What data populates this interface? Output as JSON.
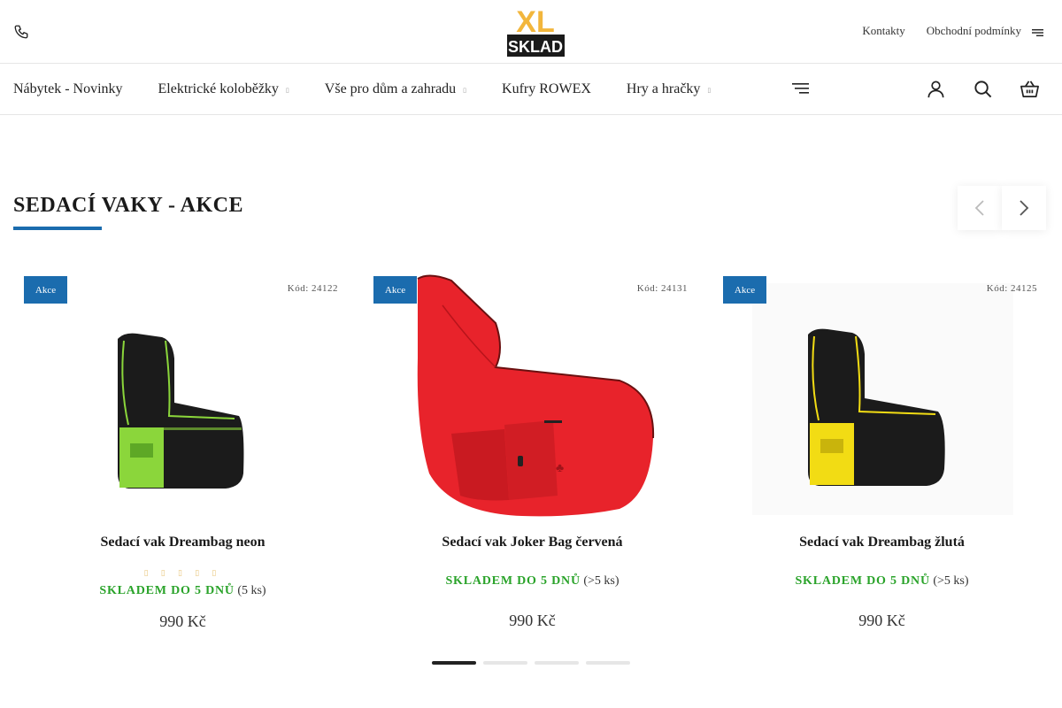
{
  "header": {
    "phone_icon": "phone-icon",
    "logo": {
      "top": "XL",
      "bottom": "SKLAD",
      "color": "#f2b63c"
    },
    "links": [
      "Kontakty",
      "Obchodní podmínky"
    ],
    "menu_icon": "menu-icon"
  },
  "nav": {
    "items": [
      {
        "label": "Nábytek - Novinky",
        "has_dropdown": false
      },
      {
        "label": "Elektrické koloběžky",
        "has_dropdown": true
      },
      {
        "label": "Vše pro dům a zahradu",
        "has_dropdown": true
      },
      {
        "label": "Kufry ROWEX",
        "has_dropdown": false
      },
      {
        "label": "Hry a hračky",
        "has_dropdown": true
      }
    ],
    "caret": "▯",
    "icons": [
      "more-menu-icon",
      "user-icon",
      "search-icon",
      "cart-icon"
    ]
  },
  "section": {
    "title": "SEDACÍ VAKY - AKCE",
    "accent": "#1b6cae"
  },
  "products": [
    {
      "badge": "Akce",
      "code": "Kód: 24122",
      "name": "Sedací vak Dreambag neon",
      "stars": "▯ ▯ ▯ ▯ ▯",
      "stock_label": "SKLADEM DO 5 DNŮ",
      "stock_count": "(5 ks)",
      "price": "990 Kč",
      "color": "#8bd63b"
    },
    {
      "badge": "Akce",
      "code": "Kód: 24131",
      "name": "Sedací vak Joker Bag červená",
      "stars": "",
      "stock_label": "SKLADEM DO 5 DNŮ",
      "stock_count": "(>5 ks)",
      "price": "990 Kč",
      "color": "#e8232b"
    },
    {
      "badge": "Akce",
      "code": "Kód: 24125",
      "name": "Sedací vak Dreambag žlutá",
      "stars": "",
      "stock_label": "SKLADEM DO 5 DNŮ",
      "stock_count": "(>5 ks)",
      "price": "990 Kč",
      "color": "#f2dc14"
    }
  ],
  "pagination": {
    "pages": 4,
    "active": 1
  }
}
